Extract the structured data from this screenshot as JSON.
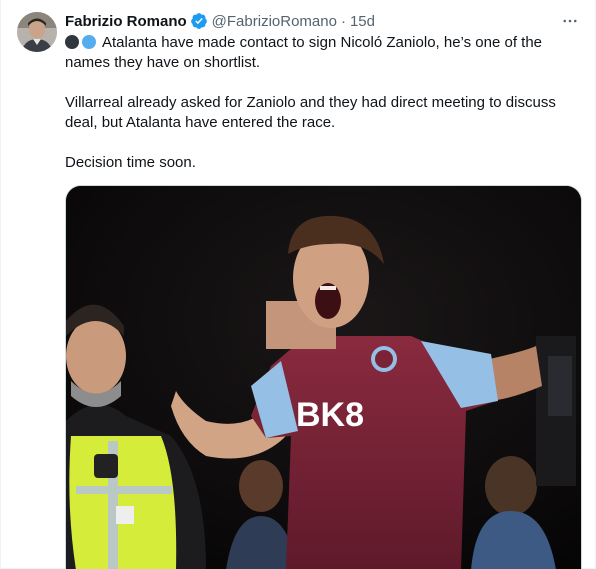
{
  "tweet": {
    "author_name": "Fabrizio Romano",
    "handle": "@FabrizioRomano",
    "separator": "·",
    "time": "15d",
    "line1": "Atalanta have made contact to sign Nicoló Zaniolo, he’s one of the names they have on shortlist.",
    "line2": "Villarreal already asked for Zaniolo and they had direct meeting to discuss deal, but Atalanta have entered the race.",
    "line3": "Decision time soon.",
    "emojis": [
      "black-circle-icon",
      "blue-circle-icon"
    ]
  },
  "media": {
    "shirt_sponsor": "BK8"
  },
  "colors": {
    "verified": "#1d9bf0",
    "secondary_text": "#536471",
    "shirt_claret": "#7a2336",
    "shirt_blue": "#95bfe5",
    "hi_vis": "#d6ec3a"
  }
}
